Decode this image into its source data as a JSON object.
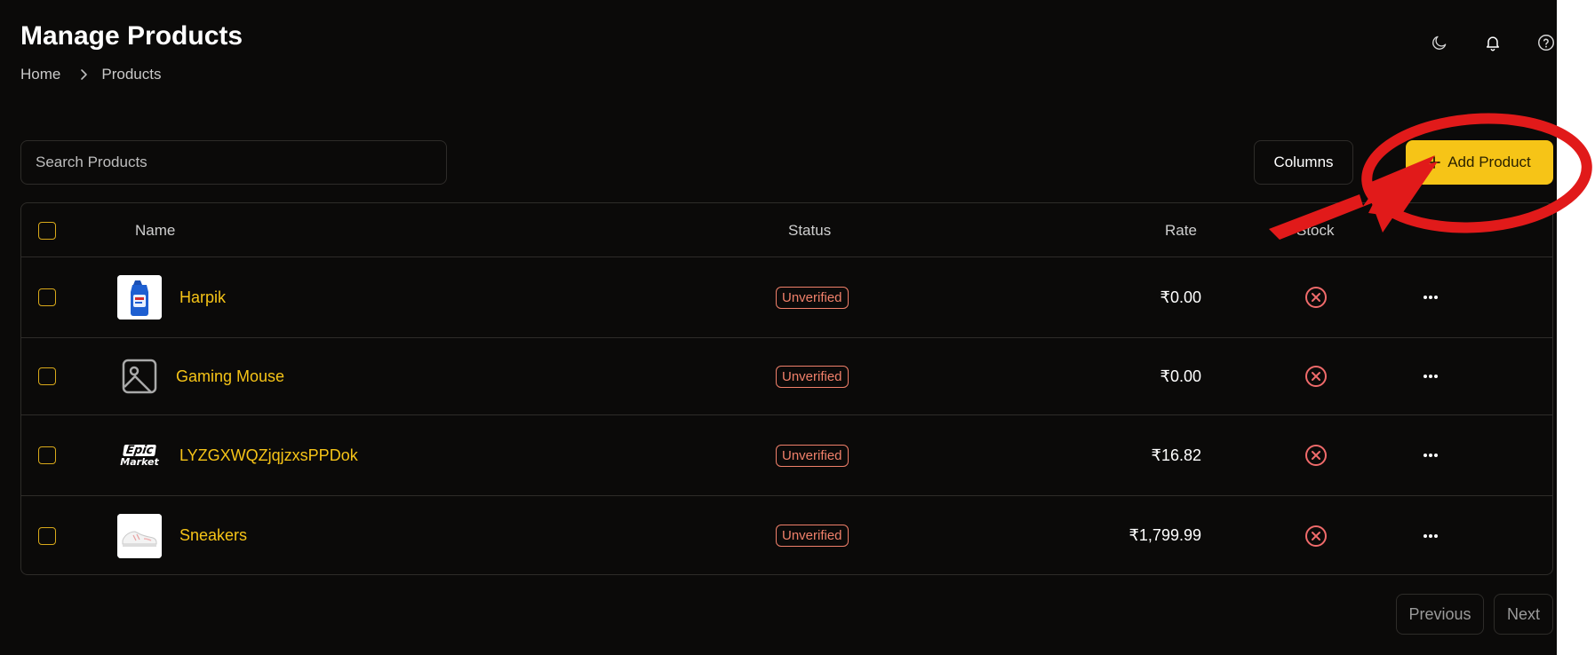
{
  "page": {
    "title": "Manage Products",
    "breadcrumb": [
      "Home",
      "Products"
    ]
  },
  "header_icons": [
    "moon-icon",
    "bell-icon",
    "help-icon"
  ],
  "search": {
    "placeholder": "Search Products",
    "value": ""
  },
  "toolbar": {
    "columns_label": "Columns",
    "add_label": "Add Product"
  },
  "table": {
    "headers": {
      "name": "Name",
      "status": "Status",
      "rate": "Rate",
      "stock": "Stock"
    },
    "rows": [
      {
        "name": "Harpik",
        "status": "Unverified",
        "rate": "₹0.00",
        "stock_icon": "x-circle-icon",
        "thumb": "cleaner-bottle-image"
      },
      {
        "name": "Gaming Mouse",
        "status": "Unverified",
        "rate": "₹0.00",
        "stock_icon": "x-circle-icon",
        "thumb": "image-placeholder-icon"
      },
      {
        "name": "LYZGXWQZjqjzxsPPDok",
        "status": "Unverified",
        "rate": "₹16.82",
        "stock_icon": "x-circle-icon",
        "thumb": "epic-market-logo",
        "thumb_text": [
          "Epic",
          "Market"
        ]
      },
      {
        "name": "Sneakers",
        "status": "Unverified",
        "rate": "₹1,799.99",
        "stock_icon": "x-circle-icon",
        "thumb": "sneaker-image"
      }
    ]
  },
  "pagination": {
    "previous_label": "Previous",
    "next_label": "Next"
  },
  "colors": {
    "background": "#0b0a09",
    "accent": "#f6c417",
    "badge": "#f0806a",
    "stock_out": "#f06b6b",
    "annotation": "#e11a1a"
  }
}
